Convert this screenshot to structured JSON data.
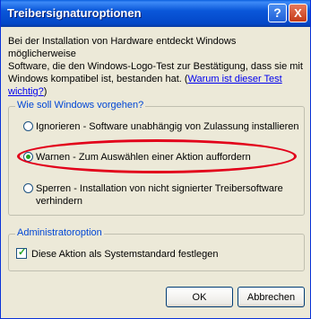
{
  "window": {
    "title": "Treibersignaturoptionen",
    "help_symbol": "?",
    "close_symbol": "X"
  },
  "intro": {
    "line1": "Bei der Installation von Hardware entdeckt Windows möglicherweise",
    "line2": "Software, die den Windows-Logo-Test zur Bestätigung, dass sie mit",
    "line3_prefix": "Windows kompatibel ist, bestanden hat. (",
    "link_part1": "Warum ist dieser Test",
    "link_part2": "wichtig?",
    "line4_suffix": ")"
  },
  "behavior_group": {
    "title": "Wie soll Windows vorgehen?",
    "options": [
      {
        "line1": "Ignorieren - Software unabhängig von Zulassung installieren",
        "line2": "",
        "selected": false
      },
      {
        "line1": "Warnen - Zum Auswählen einer Aktion auffordern",
        "line2": "",
        "selected": true
      },
      {
        "line1": "Sperren - Installation von nicht signierter Treibersoftware",
        "line2": "verhindern",
        "selected": false
      }
    ]
  },
  "admin_group": {
    "title": "Administratoroption",
    "checkbox_label": "Diese Aktion als Systemstandard festlegen",
    "checked": true
  },
  "buttons": {
    "ok": "OK",
    "cancel": "Abbrechen"
  },
  "colors": {
    "titlebar": "#0a57d9",
    "group_title": "#0046d5",
    "highlight_oval": "#e2001a",
    "radio_dot": "#21a121"
  }
}
